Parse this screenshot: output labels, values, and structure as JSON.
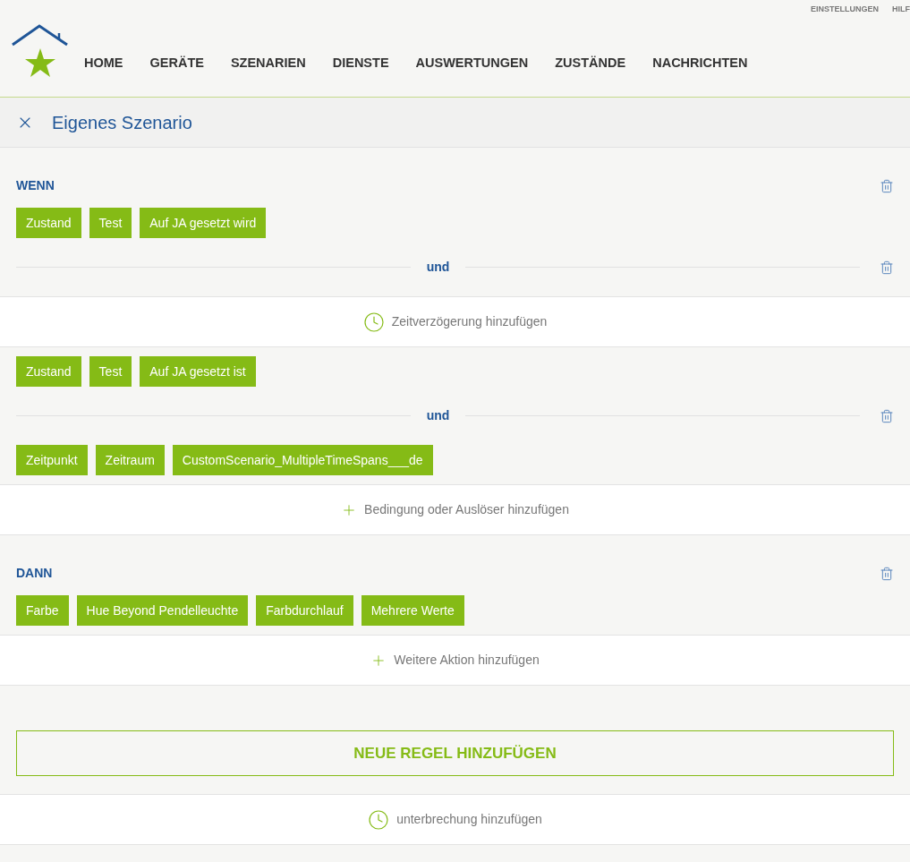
{
  "top_links": [
    "EINSTELLUNGEN",
    "HILF"
  ],
  "nav": [
    "HOME",
    "GERÄTE",
    "SZENARIEN",
    "DIENSTE",
    "AUSWERTUNGEN",
    "ZUSTÄNDE",
    "NACHRICHTEN"
  ],
  "page_title": "Eigenes Szenario",
  "blocks": [
    {
      "kind": "panel",
      "heading": "WENN",
      "rows": [
        {
          "kind": "chips",
          "chips": [
            "Zustand",
            "Test",
            "Auf JA gesetzt wird"
          ]
        },
        {
          "kind": "separator",
          "label": "und"
        }
      ]
    },
    {
      "kind": "delay",
      "label": "Zeitverzögerung hinzufügen"
    },
    {
      "kind": "panel",
      "rows": [
        {
          "kind": "chips",
          "chips": [
            "Zustand",
            "Test",
            "Auf JA gesetzt ist"
          ]
        },
        {
          "kind": "separator",
          "label": "und"
        },
        {
          "kind": "chips",
          "chips": [
            "Zeitpunkt",
            "Zeitraum",
            "CustomScenario_MultipleTimeSpans___de"
          ]
        }
      ]
    },
    {
      "kind": "add",
      "label": "Bedingung oder Auslöser hinzufügen"
    },
    {
      "kind": "panel",
      "heading": "DANN",
      "rows": [
        {
          "kind": "chips",
          "chips": [
            "Farbe",
            "Hue Beyond Pendelleuchte",
            "Farbdurchlauf",
            "Mehrere Werte"
          ]
        }
      ]
    },
    {
      "kind": "add",
      "label": "Weitere Aktion hinzufügen"
    },
    {
      "kind": "button",
      "label": "NEUE REGEL HINZUFÜGEN"
    },
    {
      "kind": "delay",
      "label": "unterbrechung hinzufügen"
    }
  ]
}
